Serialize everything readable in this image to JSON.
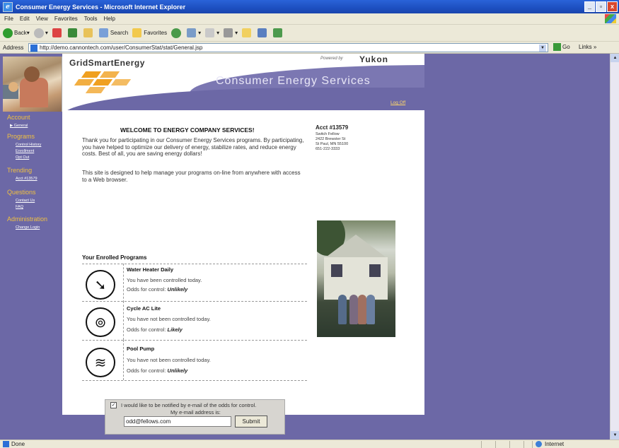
{
  "window": {
    "title": "Consumer Energy Services - Microsoft Internet Explorer"
  },
  "menu": [
    "File",
    "Edit",
    "View",
    "Favorites",
    "Tools",
    "Help"
  ],
  "toolbar": {
    "back": "Back",
    "search": "Search",
    "favorites": "Favorites"
  },
  "address": {
    "label": "Address",
    "url": "http://demo.cannontech.com/user/ConsumerStat/stat/General.jsp",
    "go": "Go",
    "links": "Links"
  },
  "status": {
    "text": "Done",
    "zone": "Internet"
  },
  "header": {
    "logo": "GridSmartEnergy",
    "powered_by": "Powered by",
    "yukon": "Yukon",
    "title": "Consumer Energy Services",
    "logoff": "Log Off"
  },
  "nav": {
    "account": {
      "title": "Account",
      "links": [
        "General"
      ]
    },
    "programs": {
      "title": "Programs",
      "links": [
        "Control History",
        "Enrollment",
        "Opt Out"
      ]
    },
    "trending": {
      "title": "Trending",
      "links": [
        "Acct #13579"
      ]
    },
    "questions": {
      "title": "Questions",
      "links": [
        "Contact Us",
        "FAQ"
      ]
    },
    "administration": {
      "title": "Administration",
      "links": [
        "Change Login"
      ]
    }
  },
  "main": {
    "welcome": "WELCOME TO ENERGY COMPANY SERVICES!",
    "para1": "Thank you for participating in our Consumer Energy Services programs. By participating, you have helped to optimize our delivery of energy, stabilize rates, and reduce energy costs. Best of all, you are saving energy dollars!",
    "para2": "This site is designed to help manage your programs on-line from anywhere with access to a Web browser.",
    "enrolled_title": "Your Enrolled Programs",
    "odds_label": "Odds for control:",
    "programs": [
      {
        "name": "Water Heater Daily",
        "status": "You have been controlled today.",
        "odds": "Unlikely",
        "icon": "water-heater-icon"
      },
      {
        "name": "Cycle AC Lite",
        "status": "You have not been controlled today.",
        "odds": "Likely",
        "icon": "ac-icon"
      },
      {
        "name": "Pool Pump",
        "status": "You have not been controlled today.",
        "odds": "Unlikely",
        "icon": "pool-pump-icon"
      }
    ]
  },
  "account": {
    "number": "Acct #13579",
    "name": "Switch Fellow",
    "street": "2422 Brewster St",
    "city": "St Paul, MN 55100",
    "phone": "651-222-3333"
  },
  "notify": {
    "checked": true,
    "label": "I would like to be notified by e-mail of the odds for control.",
    "email_label": "My e-mail address is:",
    "email": "odd@fellows.com",
    "submit": "Submit"
  }
}
